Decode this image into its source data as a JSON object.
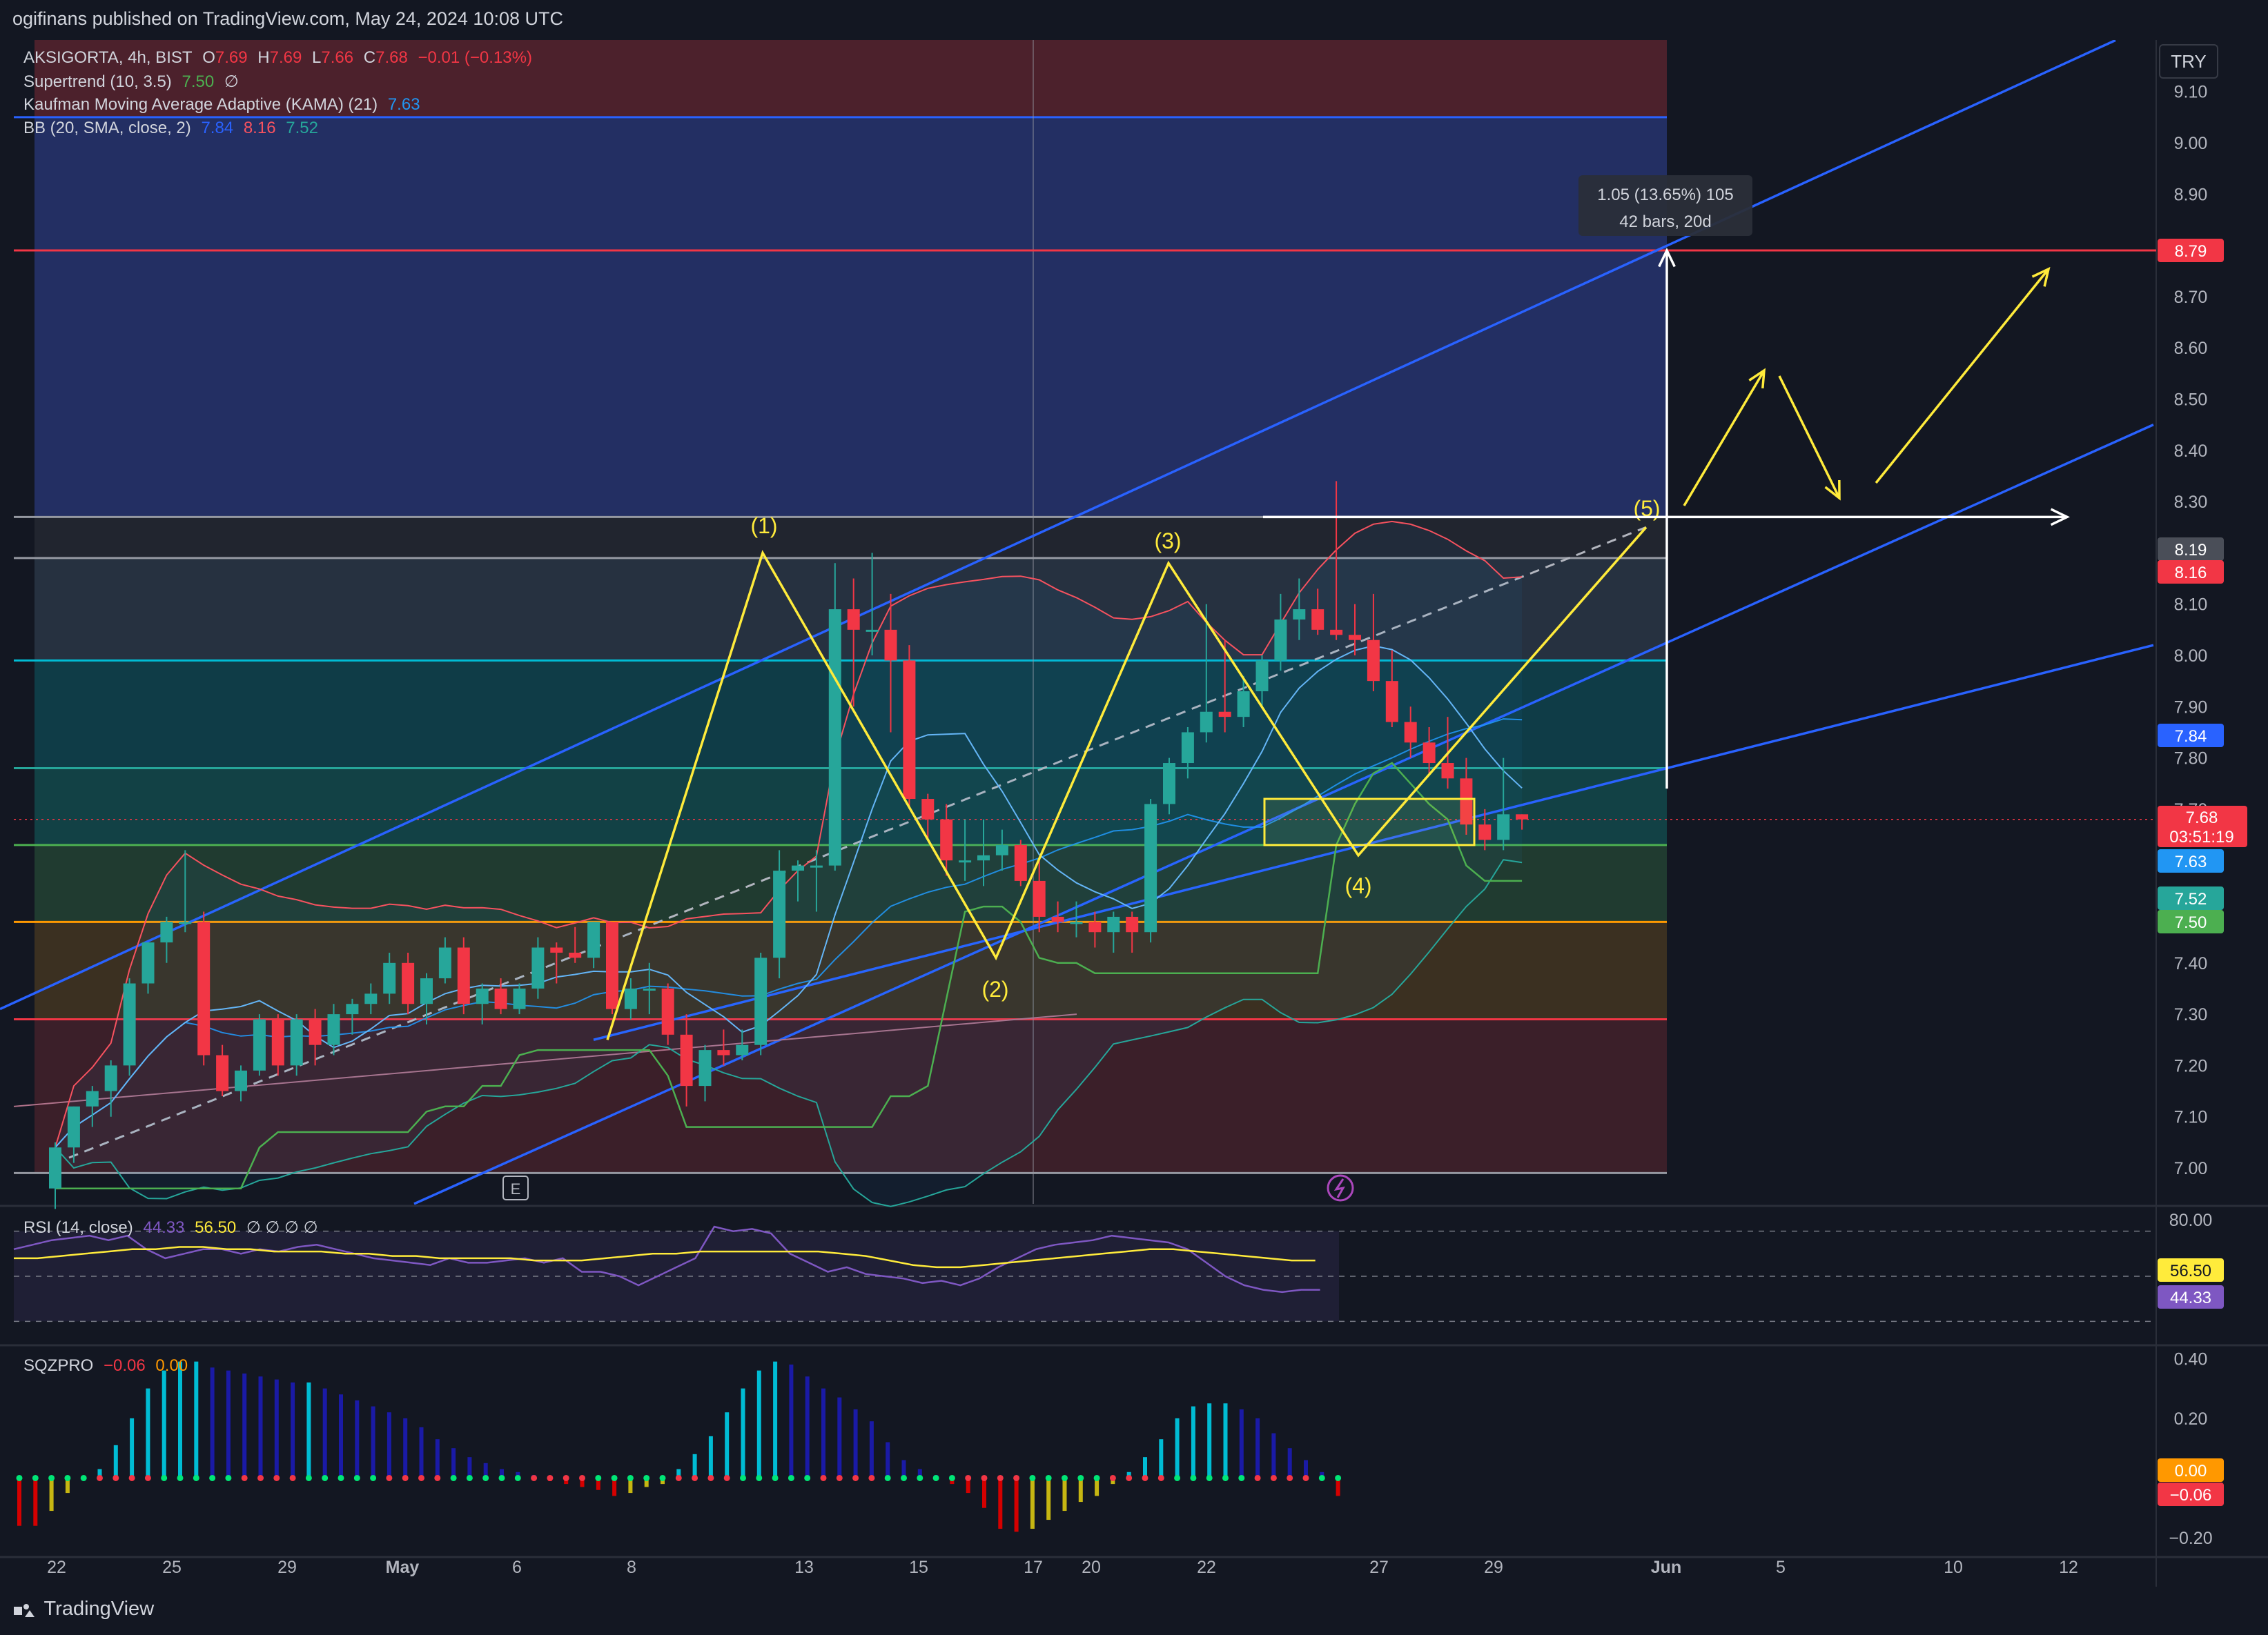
{
  "header": {
    "published_line": "ogifinans published on TradingView.com, May 24, 2024 10:08 UTC"
  },
  "footer": {
    "brand": "TradingView"
  },
  "currency_button": "TRY",
  "legend": {
    "symbol": "AKSIGORTA, 4h, BIST",
    "open_label": "O",
    "open": "7.69",
    "high_label": "H",
    "high": "7.69",
    "low_label": "L",
    "low": "7.66",
    "close_label": "C",
    "close": "7.68",
    "change": "−0.01 (−0.13%)",
    "supertrend_label": "Supertrend (10, 3.5)",
    "supertrend_value": "7.50",
    "kama_label": "Kaufman Moving Average Adaptive (KAMA) (21)",
    "kama_value": "7.63",
    "bb_label": "BB (20, SMA, close, 2)",
    "bb_basis": "7.84",
    "bb_upper": "8.16",
    "bb_lower": "7.52",
    "rsi_label": "RSI (14, close)",
    "rsi_value": "44.33",
    "rsi_ma": "56.50",
    "sqz_label": "SQZPRO",
    "sqz_value": "−0.06",
    "sqz_second": "0.00",
    "null_glyphs": "∅  ∅  ∅  ∅",
    "null_glyph": "∅"
  },
  "measure_box": {
    "line1": "1.05 (13.65%) 105",
    "line2": "42 bars, 20d"
  },
  "price_tags": {
    "target": "8.79",
    "fib_top": "8.19",
    "bb_upper": "8.16",
    "bb_basis": "7.84",
    "last": "7.68",
    "countdown": "03:51:19",
    "kama": "7.63",
    "bb_lower": "7.52",
    "supertrend": "7.50",
    "rsi_ma": "56.50",
    "rsi": "44.33",
    "sqz_zero": "0.00",
    "sqz": "−0.06"
  },
  "colors": {
    "up": "#26a69a",
    "down": "#f23645",
    "wave": "#ffeb3b",
    "channel": "#2962ff",
    "bb": "#f7525f",
    "kama": "#2196f3",
    "supertrend": "#4caf50",
    "rsi": "#7e57c2",
    "rsi_ma": "#ffeb3b"
  },
  "chart_data": [
    {
      "type": "candlestick",
      "symbol": "AKSIGORTA",
      "timeframe": "4h",
      "exchange": "BIST",
      "currency": "TRY",
      "x_tick_labels": [
        "22",
        "25",
        "29",
        "May",
        "6",
        "8",
        "13",
        "15",
        "17",
        "20",
        "22",
        "27",
        "29",
        "Jun",
        "5",
        "10",
        "12"
      ],
      "y_tick_labels": [
        "7.00",
        "7.10",
        "7.20",
        "7.30",
        "7.40",
        "7.70",
        "7.80",
        "7.90",
        "8.00",
        "8.10",
        "8.30",
        "8.40",
        "8.50",
        "8.60",
        "8.70",
        "8.90",
        "9.00",
        "9.10"
      ],
      "ylim": [
        6.93,
        9.17
      ],
      "candles": [
        {
          "o": 6.96,
          "h": 7.05,
          "l": 6.92,
          "c": 7.04
        },
        {
          "o": 7.04,
          "h": 7.12,
          "l": 7.01,
          "c": 7.12
        },
        {
          "o": 7.12,
          "h": 7.16,
          "l": 7.08,
          "c": 7.15
        },
        {
          "o": 7.15,
          "h": 7.21,
          "l": 7.1,
          "c": 7.2
        },
        {
          "o": 7.2,
          "h": 7.37,
          "l": 7.18,
          "c": 7.36
        },
        {
          "o": 7.36,
          "h": 7.44,
          "l": 7.34,
          "c": 7.44
        },
        {
          "o": 7.44,
          "h": 7.49,
          "l": 7.4,
          "c": 7.48
        },
        {
          "o": 7.48,
          "h": 7.62,
          "l": 7.46,
          "c": 7.48
        },
        {
          "o": 7.48,
          "h": 7.5,
          "l": 7.2,
          "c": 7.22
        },
        {
          "o": 7.22,
          "h": 7.24,
          "l": 7.14,
          "c": 7.15
        },
        {
          "o": 7.15,
          "h": 7.2,
          "l": 7.13,
          "c": 7.19
        },
        {
          "o": 7.19,
          "h": 7.3,
          "l": 7.18,
          "c": 7.29
        },
        {
          "o": 7.29,
          "h": 7.3,
          "l": 7.18,
          "c": 7.2
        },
        {
          "o": 7.2,
          "h": 7.3,
          "l": 7.18,
          "c": 7.29
        },
        {
          "o": 7.29,
          "h": 7.31,
          "l": 7.2,
          "c": 7.24
        },
        {
          "o": 7.24,
          "h": 7.32,
          "l": 7.22,
          "c": 7.3
        },
        {
          "o": 7.3,
          "h": 7.33,
          "l": 7.26,
          "c": 7.32
        },
        {
          "o": 7.32,
          "h": 7.36,
          "l": 7.3,
          "c": 7.34
        },
        {
          "o": 7.34,
          "h": 7.42,
          "l": 7.32,
          "c": 7.4
        },
        {
          "o": 7.4,
          "h": 7.42,
          "l": 7.3,
          "c": 7.32
        },
        {
          "o": 7.32,
          "h": 7.38,
          "l": 7.28,
          "c": 7.37
        },
        {
          "o": 7.37,
          "h": 7.45,
          "l": 7.36,
          "c": 7.43
        },
        {
          "o": 7.43,
          "h": 7.45,
          "l": 7.3,
          "c": 7.32
        },
        {
          "o": 7.32,
          "h": 7.36,
          "l": 7.28,
          "c": 7.35
        },
        {
          "o": 7.35,
          "h": 7.37,
          "l": 7.3,
          "c": 7.31
        },
        {
          "o": 7.31,
          "h": 7.36,
          "l": 7.3,
          "c": 7.35
        },
        {
          "o": 7.35,
          "h": 7.45,
          "l": 7.33,
          "c": 7.43
        },
        {
          "o": 7.43,
          "h": 7.44,
          "l": 7.36,
          "c": 7.42
        },
        {
          "o": 7.42,
          "h": 7.47,
          "l": 7.4,
          "c": 7.41
        },
        {
          "o": 7.41,
          "h": 7.48,
          "l": 7.39,
          "c": 7.48
        },
        {
          "o": 7.48,
          "h": 7.48,
          "l": 7.3,
          "c": 7.31
        },
        {
          "o": 7.31,
          "h": 7.37,
          "l": 7.29,
          "c": 7.35
        },
        {
          "o": 7.35,
          "h": 7.4,
          "l": 7.3,
          "c": 7.35
        },
        {
          "o": 7.35,
          "h": 7.36,
          "l": 7.24,
          "c": 7.26
        },
        {
          "o": 7.26,
          "h": 7.3,
          "l": 7.12,
          "c": 7.16
        },
        {
          "o": 7.16,
          "h": 7.24,
          "l": 7.13,
          "c": 7.23
        },
        {
          "o": 7.23,
          "h": 7.27,
          "l": 7.2,
          "c": 7.22
        },
        {
          "o": 7.22,
          "h": 7.27,
          "l": 7.21,
          "c": 7.24
        },
        {
          "o": 7.24,
          "h": 7.42,
          "l": 7.22,
          "c": 7.41
        },
        {
          "o": 7.41,
          "h": 7.62,
          "l": 7.37,
          "c": 7.58
        },
        {
          "o": 7.58,
          "h": 7.6,
          "l": 7.52,
          "c": 7.59
        },
        {
          "o": 7.59,
          "h": 7.62,
          "l": 7.5,
          "c": 7.59
        },
        {
          "o": 7.59,
          "h": 8.18,
          "l": 7.58,
          "c": 8.09
        },
        {
          "o": 8.09,
          "h": 8.15,
          "l": 7.9,
          "c": 8.05
        },
        {
          "o": 8.05,
          "h": 8.2,
          "l": 8.0,
          "c": 8.05
        },
        {
          "o": 8.05,
          "h": 8.12,
          "l": 7.85,
          "c": 7.99
        },
        {
          "o": 7.99,
          "h": 8.02,
          "l": 7.7,
          "c": 7.72
        },
        {
          "o": 7.72,
          "h": 7.73,
          "l": 7.64,
          "c": 7.68
        },
        {
          "o": 7.68,
          "h": 7.71,
          "l": 7.57,
          "c": 7.6
        },
        {
          "o": 7.6,
          "h": 7.68,
          "l": 7.56,
          "c": 7.6
        },
        {
          "o": 7.6,
          "h": 7.68,
          "l": 7.55,
          "c": 7.61
        },
        {
          "o": 7.61,
          "h": 7.66,
          "l": 7.58,
          "c": 7.63
        },
        {
          "o": 7.63,
          "h": 7.64,
          "l": 7.55,
          "c": 7.56
        },
        {
          "o": 7.56,
          "h": 7.6,
          "l": 7.46,
          "c": 7.49
        },
        {
          "o": 7.49,
          "h": 7.52,
          "l": 7.46,
          "c": 7.48
        },
        {
          "o": 7.48,
          "h": 7.52,
          "l": 7.45,
          "c": 7.48
        },
        {
          "o": 7.48,
          "h": 7.5,
          "l": 7.43,
          "c": 7.46
        },
        {
          "o": 7.46,
          "h": 7.5,
          "l": 7.42,
          "c": 7.49
        },
        {
          "o": 7.49,
          "h": 7.5,
          "l": 7.42,
          "c": 7.46
        },
        {
          "o": 7.46,
          "h": 7.72,
          "l": 7.44,
          "c": 7.71
        },
        {
          "o": 7.71,
          "h": 7.8,
          "l": 7.69,
          "c": 7.79
        },
        {
          "o": 7.79,
          "h": 7.86,
          "l": 7.76,
          "c": 7.85
        },
        {
          "o": 7.85,
          "h": 8.1,
          "l": 7.83,
          "c": 7.89
        },
        {
          "o": 7.89,
          "h": 8.03,
          "l": 7.85,
          "c": 7.88
        },
        {
          "o": 7.88,
          "h": 7.96,
          "l": 7.86,
          "c": 7.93
        },
        {
          "o": 7.93,
          "h": 8.0,
          "l": 7.9,
          "c": 7.99
        },
        {
          "o": 7.99,
          "h": 8.12,
          "l": 7.97,
          "c": 8.07
        },
        {
          "o": 8.07,
          "h": 8.15,
          "l": 8.03,
          "c": 8.09
        },
        {
          "o": 8.09,
          "h": 8.13,
          "l": 8.04,
          "c": 8.05
        },
        {
          "o": 8.05,
          "h": 8.34,
          "l": 8.03,
          "c": 8.04
        },
        {
          "o": 8.04,
          "h": 8.1,
          "l": 8.0,
          "c": 8.03
        },
        {
          "o": 8.03,
          "h": 8.12,
          "l": 7.93,
          "c": 7.95
        },
        {
          "o": 7.95,
          "h": 8.01,
          "l": 7.86,
          "c": 7.87
        },
        {
          "o": 7.87,
          "h": 7.9,
          "l": 7.8,
          "c": 7.83
        },
        {
          "o": 7.83,
          "h": 7.86,
          "l": 7.77,
          "c": 7.79
        },
        {
          "o": 7.79,
          "h": 7.88,
          "l": 7.74,
          "c": 7.76
        },
        {
          "o": 7.76,
          "h": 7.8,
          "l": 7.65,
          "c": 7.67
        },
        {
          "o": 7.67,
          "h": 7.7,
          "l": 7.62,
          "c": 7.64
        },
        {
          "o": 7.64,
          "h": 7.8,
          "l": 7.62,
          "c": 7.69
        },
        {
          "o": 7.69,
          "h": 7.69,
          "l": 7.66,
          "c": 7.68
        }
      ],
      "annotations": {
        "wave_labels": [
          "(1)",
          "(2)",
          "(3)",
          "(4)",
          "(5)"
        ],
        "wave_points": [
          {
            "label": "(1)",
            "price": 8.2
          },
          {
            "label": "(2)",
            "price": 7.41
          },
          {
            "label": "(3)",
            "price": 8.18
          },
          {
            "label": "(4)",
            "price": 7.6
          },
          {
            "label": "(5)",
            "price": 8.25
          }
        ],
        "fib_levels": [
          9.05,
          8.27,
          8.19,
          7.99,
          7.78,
          7.63,
          7.48,
          7.29,
          6.99
        ],
        "target_line": 8.79,
        "consolidation_box": [
          7.63,
          7.72
        ],
        "measure": {
          "from": 7.74,
          "to": 8.79
        }
      }
    },
    {
      "type": "line",
      "name": "RSI (14, close)",
      "y_tick_labels": [
        "80.00"
      ],
      "ylim": [
        20,
        80
      ],
      "bands": [
        70,
        50,
        30
      ],
      "series": [
        {
          "name": "RSI",
          "values": [
            62,
            64,
            66,
            67,
            68,
            66,
            68,
            62,
            58,
            60,
            62,
            62,
            60,
            62,
            61,
            63,
            64,
            62,
            60,
            58,
            57,
            56,
            55,
            58,
            56,
            56,
            57,
            58,
            56,
            58,
            52,
            52,
            50,
            46,
            50,
            54,
            58,
            72,
            70,
            71,
            69,
            60,
            56,
            52,
            54,
            51,
            50,
            49,
            47,
            48,
            46,
            49,
            54,
            58,
            62,
            64,
            65,
            66,
            68,
            67,
            66,
            65,
            62,
            56,
            50,
            46,
            44,
            43,
            44,
            44
          ]
        },
        {
          "name": "RSI MA",
          "values": [
            58,
            58,
            59,
            60,
            61,
            62,
            62,
            63,
            63,
            62,
            62,
            61,
            61,
            61,
            60,
            60,
            59,
            59,
            58,
            58,
            58,
            58,
            57,
            57,
            57,
            58,
            59,
            60,
            60,
            61,
            61,
            61,
            61,
            61,
            61,
            60,
            59,
            57,
            55,
            54,
            54,
            55,
            56,
            57,
            58,
            59,
            60,
            61,
            62,
            62,
            61,
            60,
            59,
            58,
            57,
            57
          ]
        }
      ]
    },
    {
      "type": "bar",
      "name": "SQZPRO",
      "y_tick_labels": [
        "0.40",
        "0.20",
        "−0.20"
      ],
      "ylim": [
        -0.26,
        0.44
      ],
      "values": [
        -0.16,
        -0.16,
        -0.11,
        -0.05,
        0.0,
        0.03,
        0.11,
        0.2,
        0.3,
        0.36,
        0.39,
        0.39,
        0.37,
        0.36,
        0.35,
        0.34,
        0.33,
        0.32,
        0.32,
        0.3,
        0.28,
        0.26,
        0.24,
        0.22,
        0.2,
        0.17,
        0.13,
        0.1,
        0.07,
        0.05,
        0.03,
        0.02,
        0.01,
        -0.01,
        -0.02,
        -0.03,
        -0.04,
        -0.06,
        -0.05,
        -0.03,
        -0.02,
        0.03,
        0.08,
        0.14,
        0.22,
        0.3,
        0.36,
        0.39,
        0.38,
        0.34,
        0.3,
        0.27,
        0.23,
        0.19,
        0.12,
        0.06,
        0.03,
        0.01,
        -0.02,
        -0.05,
        -0.1,
        -0.17,
        -0.18,
        -0.17,
        -0.14,
        -0.11,
        -0.08,
        -0.06,
        -0.02,
        0.02,
        0.07,
        0.13,
        0.2,
        0.24,
        0.25,
        0.25,
        0.23,
        0.2,
        0.15,
        0.1,
        0.06,
        0.02,
        -0.06
      ]
    }
  ]
}
